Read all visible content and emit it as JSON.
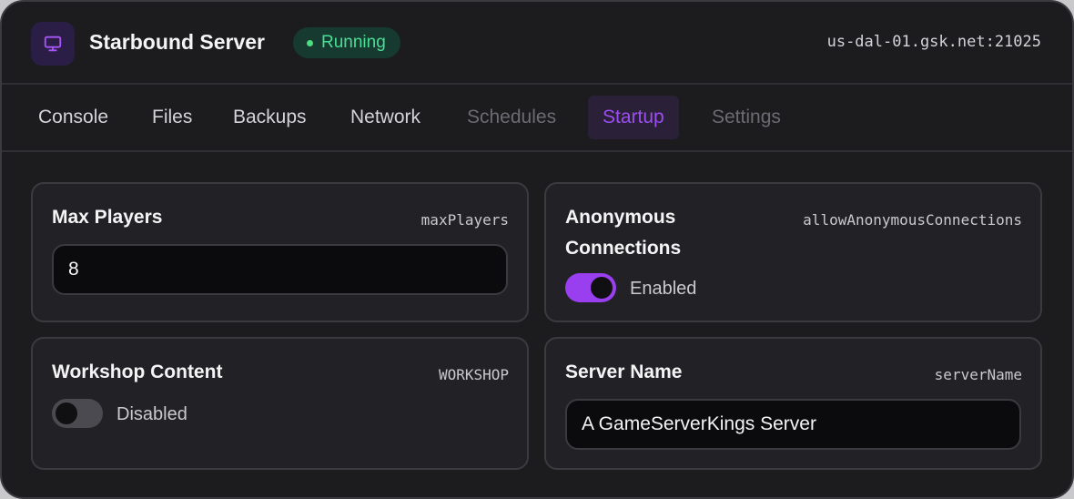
{
  "header": {
    "icon": "monitor-icon",
    "title": "Starbound Server",
    "status": "Running",
    "status_color": "#4ade80",
    "address": "us-dal-01.gsk.net:21025"
  },
  "tabs": [
    {
      "label": "Console",
      "state": "normal"
    },
    {
      "label": "Files",
      "state": "normal"
    },
    {
      "label": "Backups",
      "state": "normal"
    },
    {
      "label": "Network",
      "state": "normal"
    },
    {
      "label": "Schedules",
      "state": "disabled"
    },
    {
      "label": "Startup",
      "state": "active"
    },
    {
      "label": "Settings",
      "state": "disabled"
    }
  ],
  "accent_color": "#9d4cf2",
  "cards": {
    "max_players": {
      "title": "Max Players",
      "key": "maxPlayers",
      "value": "8"
    },
    "anonymous": {
      "title_line1": "Anonymous",
      "title_line2": "Connections",
      "key": "allowAnonymousConnections",
      "enabled": true,
      "state_label": "Enabled"
    },
    "workshop": {
      "title": "Workshop Content",
      "key": "WORKSHOP",
      "enabled": false,
      "state_label": "Disabled"
    },
    "server_name": {
      "title": "Server Name",
      "key": "serverName",
      "value": "A GameServerKings Server"
    }
  }
}
